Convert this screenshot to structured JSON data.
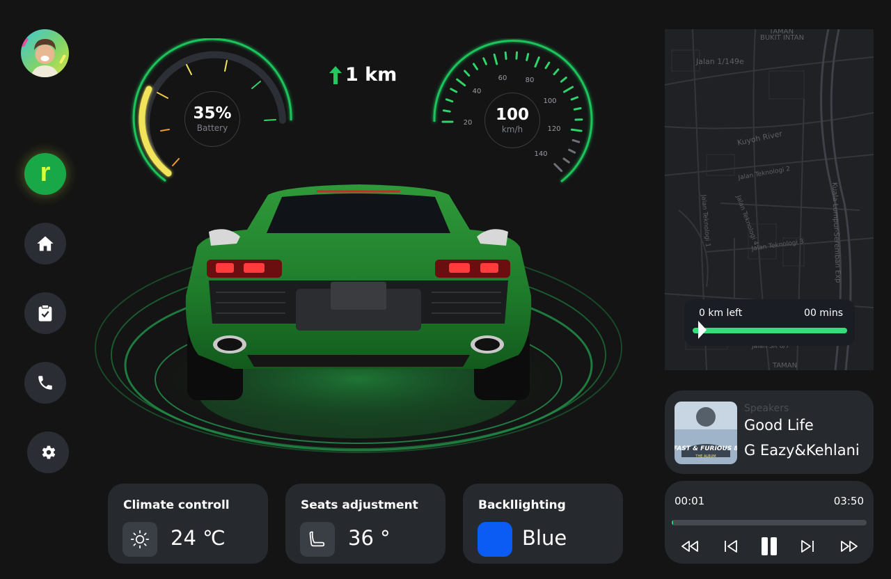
{
  "sidebar": {
    "avatar_alt": "",
    "brand_letter": "r",
    "items": [
      {
        "icon": "home-icon"
      },
      {
        "icon": "clipboard-check-icon"
      },
      {
        "icon": "phone-icon"
      },
      {
        "icon": "gear-icon"
      }
    ]
  },
  "battery": {
    "value": "35%",
    "label": "Battery",
    "level": 0.35
  },
  "speed": {
    "value": "100",
    "unit": "km/h",
    "ticks": [
      "20",
      "40",
      "60",
      "80",
      "100",
      "120",
      "140"
    ]
  },
  "navigation": {
    "distance": "1 km"
  },
  "cards": {
    "climate": {
      "title": "Climate controll",
      "value": "24 ℃",
      "icon": "sun-icon"
    },
    "seats": {
      "title": "Seats adjustment",
      "value": "36 °",
      "icon": "seat-icon"
    },
    "backlight": {
      "title": "Backllighting",
      "value": "Blue",
      "color": "#0a5cf5"
    }
  },
  "map": {
    "labels": [
      "TAMAN",
      "BUKIT INTAN",
      "Jalan 1/149e",
      "Kuyoh River",
      "Jalan Teknologi 2",
      "Jalan Teknologi 4",
      "Jalan Teknologi 1",
      "Jalan Teknologi 3",
      "Kuala Lumpur-Seremban Exp",
      "Jalan SR 6/7",
      "TAMAN"
    ],
    "trip_left": "0 km left",
    "trip_time": "00 mins",
    "trip_progress": 0.0
  },
  "music": {
    "source": "Speakers",
    "title": "Good Life",
    "artist": "G Eazy&Kehlani",
    "album_text": "FAST & FURIOUS 8",
    "album_sub": "THE ALBUM",
    "current": "00:01",
    "total": "03:50",
    "progress": 0.004
  },
  "colors": {
    "accent": "#1fc25a",
    "battery_arc": "#f2e45a",
    "background": "#141414",
    "card": "#26292e"
  }
}
